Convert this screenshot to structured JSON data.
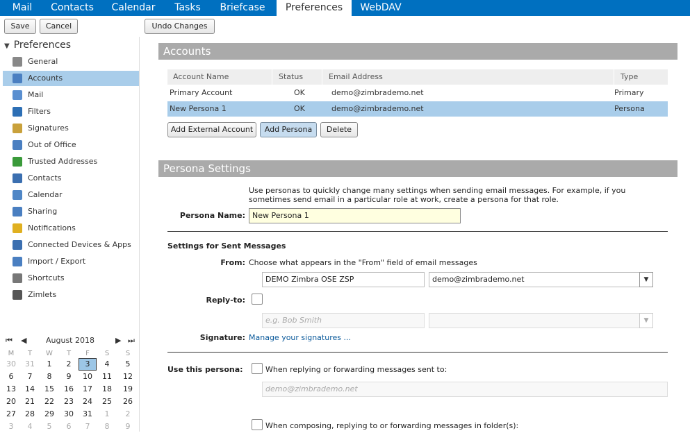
{
  "tabs": [
    "Mail",
    "Contacts",
    "Calendar",
    "Tasks",
    "Briefcase",
    "Preferences",
    "WebDAV"
  ],
  "toolbar": {
    "save": "Save",
    "cancel": "Cancel",
    "undo": "Undo Changes"
  },
  "sidebar": {
    "title": "Preferences",
    "items": [
      {
        "label": "General",
        "icon": "gear-icon",
        "color": "#888"
      },
      {
        "label": "Accounts",
        "icon": "accounts-icon",
        "color": "#4a7fc1"
      },
      {
        "label": "Mail",
        "icon": "mail-icon",
        "color": "#5a8fd0"
      },
      {
        "label": "Filters",
        "icon": "filter-icon",
        "color": "#2d6fb5"
      },
      {
        "label": "Signatures",
        "icon": "signature-icon",
        "color": "#c9a13b"
      },
      {
        "label": "Out of Office",
        "icon": "out-of-office-icon",
        "color": "#4a7fc1"
      },
      {
        "label": "Trusted Addresses",
        "icon": "shield-icon",
        "color": "#3a9a3a"
      },
      {
        "label": "Contacts",
        "icon": "contacts-icon",
        "color": "#3b6fb0"
      },
      {
        "label": "Calendar",
        "icon": "calendar-icon",
        "color": "#4f86c6"
      },
      {
        "label": "Sharing",
        "icon": "sharing-icon",
        "color": "#4a7fc1"
      },
      {
        "label": "Notifications",
        "icon": "bell-icon",
        "color": "#e0b020"
      },
      {
        "label": "Connected Devices & Apps",
        "icon": "device-icon",
        "color": "#3b6fb0"
      },
      {
        "label": "Import / Export",
        "icon": "import-export-icon",
        "color": "#4a7fc1"
      },
      {
        "label": "Shortcuts",
        "icon": "shortcuts-icon",
        "color": "#777"
      },
      {
        "label": "Zimlets",
        "icon": "zimlets-icon",
        "color": "#555"
      }
    ],
    "selected_index": 1
  },
  "calendar": {
    "month": "August 2018",
    "days_of_week": [
      "M",
      "T",
      "W",
      "T",
      "F",
      "S",
      "S"
    ],
    "weeks": [
      [
        "30",
        "31",
        "1",
        "2",
        "3",
        "4",
        "5"
      ],
      [
        "6",
        "7",
        "8",
        "9",
        "10",
        "11",
        "12"
      ],
      [
        "13",
        "14",
        "15",
        "16",
        "17",
        "18",
        "19"
      ],
      [
        "20",
        "21",
        "22",
        "23",
        "24",
        "25",
        "26"
      ],
      [
        "27",
        "28",
        "29",
        "30",
        "31",
        "1",
        "2"
      ],
      [
        "3",
        "4",
        "5",
        "6",
        "7",
        "8",
        "9"
      ]
    ],
    "today": "3"
  },
  "accounts": {
    "title": "Accounts",
    "columns": [
      "Account Name",
      "Status",
      "Email Address",
      "Type"
    ],
    "rows": [
      {
        "name": "Primary Account",
        "status": "OK",
        "email": "demo@zimbrademo.net",
        "type": "Primary"
      },
      {
        "name": "New Persona 1",
        "status": "OK",
        "email": "demo@zimbrademo.net",
        "type": "Persona"
      }
    ],
    "buttons": {
      "add_external": "Add External Account",
      "add_persona": "Add Persona",
      "delete": "Delete"
    }
  },
  "persona": {
    "title": "Persona Settings",
    "intro_line1": "Use personas to quickly change many settings when sending email messages. For example, if you",
    "intro_line2": "sometimes send email in a particular role at work, create a persona for that role.",
    "name_label": "Persona Name:",
    "name_value": "New Persona 1",
    "sent_heading": "Settings for Sent Messages",
    "from_label": "From:",
    "from_hint": "Choose what appears in the \"From\" field of email messages",
    "from_name": "DEMO Zimbra OSE ZSP",
    "from_address": "demo@zimbrademo.net",
    "reply_label": "Reply-to:",
    "reply_placeholder": "e.g. Bob Smith",
    "signature_label": "Signature:",
    "signature_link": "Manage your signatures ...",
    "use_label": "Use this persona:",
    "use_reply_text": "When replying or forwarding messages sent to:",
    "use_reply_placeholder": "demo@zimbrademo.net",
    "use_compose_text": "When composing, replying to or forwarding messages in folder(s):"
  }
}
